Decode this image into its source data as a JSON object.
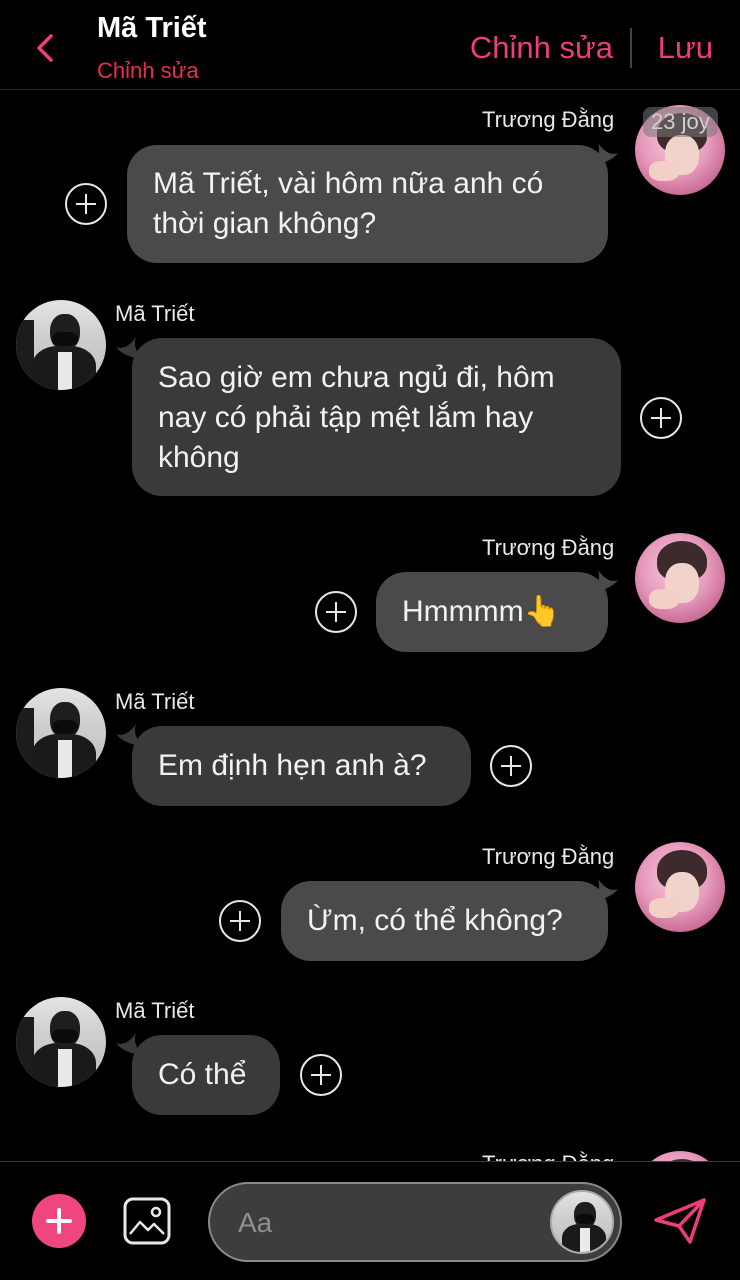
{
  "header": {
    "contact_name": "Mã Triết",
    "contact_sub": "Chỉnh sửa",
    "edit_label": "Chỉnh sửa",
    "save_label": "Lưu"
  },
  "watermark": "23 joy",
  "messages": [
    {
      "side": "right",
      "sender": "Trương Đằng",
      "text": "Mã Triết, vài hôm nữa anh có thời gian không?"
    },
    {
      "side": "left",
      "sender": "Mã Triết",
      "text": "Sao giờ em chưa ngủ đi, hôm nay có phải tập mệt lắm hay không"
    },
    {
      "side": "right",
      "sender": "Trương Đằng",
      "text": "Hmmmm👆"
    },
    {
      "side": "left",
      "sender": "Mã Triết",
      "text": "Em định hẹn anh à?"
    },
    {
      "side": "right",
      "sender": "Trương Đằng",
      "text": "Ừm, có thể không?"
    },
    {
      "side": "left",
      "sender": "Mã Triết",
      "text": "Có thể"
    },
    {
      "side": "right",
      "sender": "Trương Đằng",
      "text": ""
    }
  ],
  "composer": {
    "placeholder": "Aa"
  },
  "colors": {
    "accent": "#ee3d78",
    "sub_red": "#e8304a",
    "bubble": "#4a4a4a",
    "background": "#000000"
  },
  "icons": {
    "back": "chevron-left-icon",
    "add": "plus-icon",
    "image": "image-icon",
    "send": "send-icon",
    "message_action": "plus-circle-icon"
  }
}
